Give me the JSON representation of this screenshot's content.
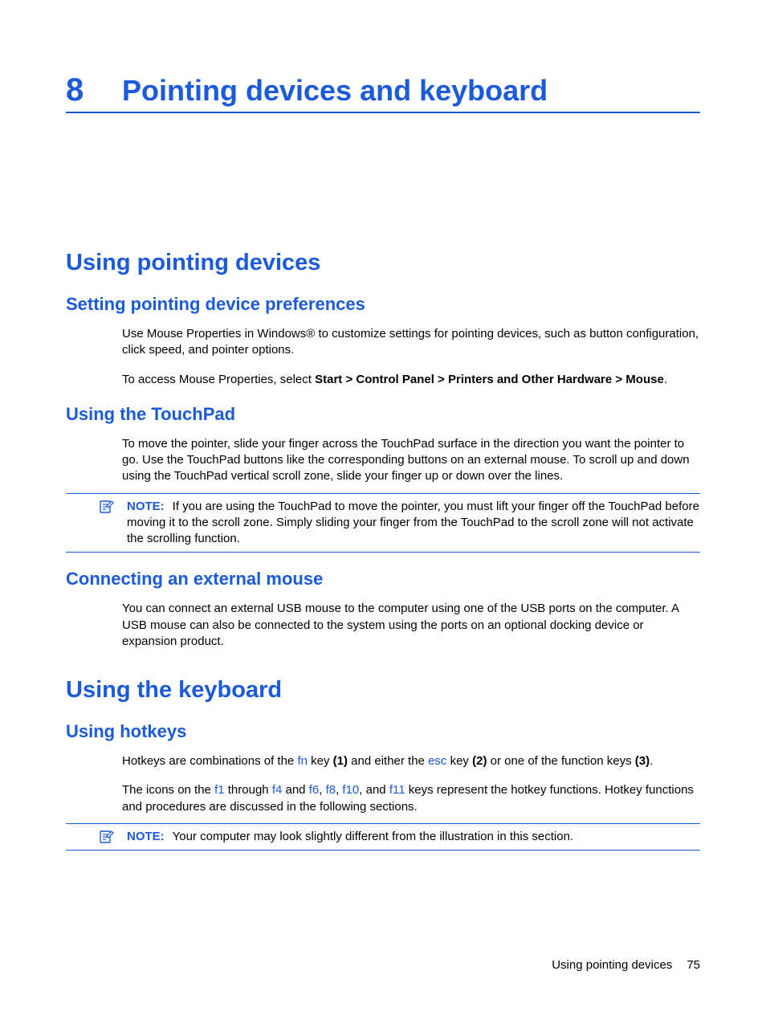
{
  "chapter": {
    "number": "8",
    "title": "Pointing devices and keyboard"
  },
  "section1": {
    "title": "Using pointing devices",
    "sub1": {
      "title": "Setting pointing device preferences",
      "p1": "Use Mouse Properties in Windows® to customize settings for pointing devices, such as button configuration, click speed, and pointer options.",
      "p2_a": "To access Mouse Properties, select ",
      "p2_b": "Start > Control Panel > Printers and Other Hardware > Mouse",
      "p2_c": "."
    },
    "sub2": {
      "title": "Using the TouchPad",
      "p1": "To move the pointer, slide your finger across the TouchPad surface in the direction you want the pointer to go. Use the TouchPad buttons like the corresponding buttons on an external mouse. To scroll up and down using the TouchPad vertical scroll zone, slide your finger up or down over the lines.",
      "note_label": "NOTE:",
      "note_text": "If you are using the TouchPad to move the pointer, you must lift your finger off the TouchPad before moving it to the scroll zone. Simply sliding your finger from the TouchPad to the scroll zone will not activate the scrolling function."
    },
    "sub3": {
      "title": "Connecting an external mouse",
      "p1": "You can connect an external USB mouse to the computer using one of the USB ports on the computer. A USB mouse can also be connected to the system using the ports on an optional docking device or expansion product."
    }
  },
  "section2": {
    "title": "Using the keyboard",
    "sub1": {
      "title": "Using hotkeys",
      "p1": {
        "a": "Hotkeys are combinations of the ",
        "fn": "fn",
        "b": " key ",
        "b_bold": "(1)",
        "c": " and either the ",
        "esc": "esc",
        "d": " key ",
        "d_bold": "(2)",
        "e": " or one of the function keys ",
        "e_bold": "(3)",
        "f": "."
      },
      "p2": {
        "a": "The icons on the ",
        "f1": "f1",
        "b": " through ",
        "f4": "f4",
        "c": " and ",
        "f6": "f6",
        "d": ", ",
        "f8": "f8",
        "e": ", ",
        "f10": "f10",
        "f": ", and ",
        "f11": "f11",
        "g": " keys represent the hotkey functions. Hotkey functions and procedures are discussed in the following sections."
      },
      "note_label": "NOTE:",
      "note_text": "Your computer may look slightly different from the illustration in this section."
    }
  },
  "footer": {
    "text": "Using pointing devices",
    "page": "75"
  }
}
